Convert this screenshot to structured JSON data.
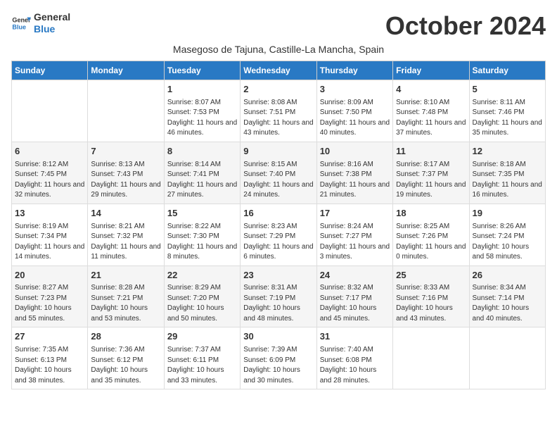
{
  "logo": {
    "line1": "General",
    "line2": "Blue"
  },
  "title": "October 2024",
  "subtitle": "Masegoso de Tajuna, Castille-La Mancha, Spain",
  "days_of_week": [
    "Sunday",
    "Monday",
    "Tuesday",
    "Wednesday",
    "Thursday",
    "Friday",
    "Saturday"
  ],
  "weeks": [
    [
      {
        "day": "",
        "info": ""
      },
      {
        "day": "",
        "info": ""
      },
      {
        "day": "1",
        "info": "Sunrise: 8:07 AM\nSunset: 7:53 PM\nDaylight: 11 hours and 46 minutes."
      },
      {
        "day": "2",
        "info": "Sunrise: 8:08 AM\nSunset: 7:51 PM\nDaylight: 11 hours and 43 minutes."
      },
      {
        "day": "3",
        "info": "Sunrise: 8:09 AM\nSunset: 7:50 PM\nDaylight: 11 hours and 40 minutes."
      },
      {
        "day": "4",
        "info": "Sunrise: 8:10 AM\nSunset: 7:48 PM\nDaylight: 11 hours and 37 minutes."
      },
      {
        "day": "5",
        "info": "Sunrise: 8:11 AM\nSunset: 7:46 PM\nDaylight: 11 hours and 35 minutes."
      }
    ],
    [
      {
        "day": "6",
        "info": "Sunrise: 8:12 AM\nSunset: 7:45 PM\nDaylight: 11 hours and 32 minutes."
      },
      {
        "day": "7",
        "info": "Sunrise: 8:13 AM\nSunset: 7:43 PM\nDaylight: 11 hours and 29 minutes."
      },
      {
        "day": "8",
        "info": "Sunrise: 8:14 AM\nSunset: 7:41 PM\nDaylight: 11 hours and 27 minutes."
      },
      {
        "day": "9",
        "info": "Sunrise: 8:15 AM\nSunset: 7:40 PM\nDaylight: 11 hours and 24 minutes."
      },
      {
        "day": "10",
        "info": "Sunrise: 8:16 AM\nSunset: 7:38 PM\nDaylight: 11 hours and 21 minutes."
      },
      {
        "day": "11",
        "info": "Sunrise: 8:17 AM\nSunset: 7:37 PM\nDaylight: 11 hours and 19 minutes."
      },
      {
        "day": "12",
        "info": "Sunrise: 8:18 AM\nSunset: 7:35 PM\nDaylight: 11 hours and 16 minutes."
      }
    ],
    [
      {
        "day": "13",
        "info": "Sunrise: 8:19 AM\nSunset: 7:34 PM\nDaylight: 11 hours and 14 minutes."
      },
      {
        "day": "14",
        "info": "Sunrise: 8:21 AM\nSunset: 7:32 PM\nDaylight: 11 hours and 11 minutes."
      },
      {
        "day": "15",
        "info": "Sunrise: 8:22 AM\nSunset: 7:30 PM\nDaylight: 11 hours and 8 minutes."
      },
      {
        "day": "16",
        "info": "Sunrise: 8:23 AM\nSunset: 7:29 PM\nDaylight: 11 hours and 6 minutes."
      },
      {
        "day": "17",
        "info": "Sunrise: 8:24 AM\nSunset: 7:27 PM\nDaylight: 11 hours and 3 minutes."
      },
      {
        "day": "18",
        "info": "Sunrise: 8:25 AM\nSunset: 7:26 PM\nDaylight: 11 hours and 0 minutes."
      },
      {
        "day": "19",
        "info": "Sunrise: 8:26 AM\nSunset: 7:24 PM\nDaylight: 10 hours and 58 minutes."
      }
    ],
    [
      {
        "day": "20",
        "info": "Sunrise: 8:27 AM\nSunset: 7:23 PM\nDaylight: 10 hours and 55 minutes."
      },
      {
        "day": "21",
        "info": "Sunrise: 8:28 AM\nSunset: 7:21 PM\nDaylight: 10 hours and 53 minutes."
      },
      {
        "day": "22",
        "info": "Sunrise: 8:29 AM\nSunset: 7:20 PM\nDaylight: 10 hours and 50 minutes."
      },
      {
        "day": "23",
        "info": "Sunrise: 8:31 AM\nSunset: 7:19 PM\nDaylight: 10 hours and 48 minutes."
      },
      {
        "day": "24",
        "info": "Sunrise: 8:32 AM\nSunset: 7:17 PM\nDaylight: 10 hours and 45 minutes."
      },
      {
        "day": "25",
        "info": "Sunrise: 8:33 AM\nSunset: 7:16 PM\nDaylight: 10 hours and 43 minutes."
      },
      {
        "day": "26",
        "info": "Sunrise: 8:34 AM\nSunset: 7:14 PM\nDaylight: 10 hours and 40 minutes."
      }
    ],
    [
      {
        "day": "27",
        "info": "Sunrise: 7:35 AM\nSunset: 6:13 PM\nDaylight: 10 hours and 38 minutes."
      },
      {
        "day": "28",
        "info": "Sunrise: 7:36 AM\nSunset: 6:12 PM\nDaylight: 10 hours and 35 minutes."
      },
      {
        "day": "29",
        "info": "Sunrise: 7:37 AM\nSunset: 6:11 PM\nDaylight: 10 hours and 33 minutes."
      },
      {
        "day": "30",
        "info": "Sunrise: 7:39 AM\nSunset: 6:09 PM\nDaylight: 10 hours and 30 minutes."
      },
      {
        "day": "31",
        "info": "Sunrise: 7:40 AM\nSunset: 6:08 PM\nDaylight: 10 hours and 28 minutes."
      },
      {
        "day": "",
        "info": ""
      },
      {
        "day": "",
        "info": ""
      }
    ]
  ]
}
